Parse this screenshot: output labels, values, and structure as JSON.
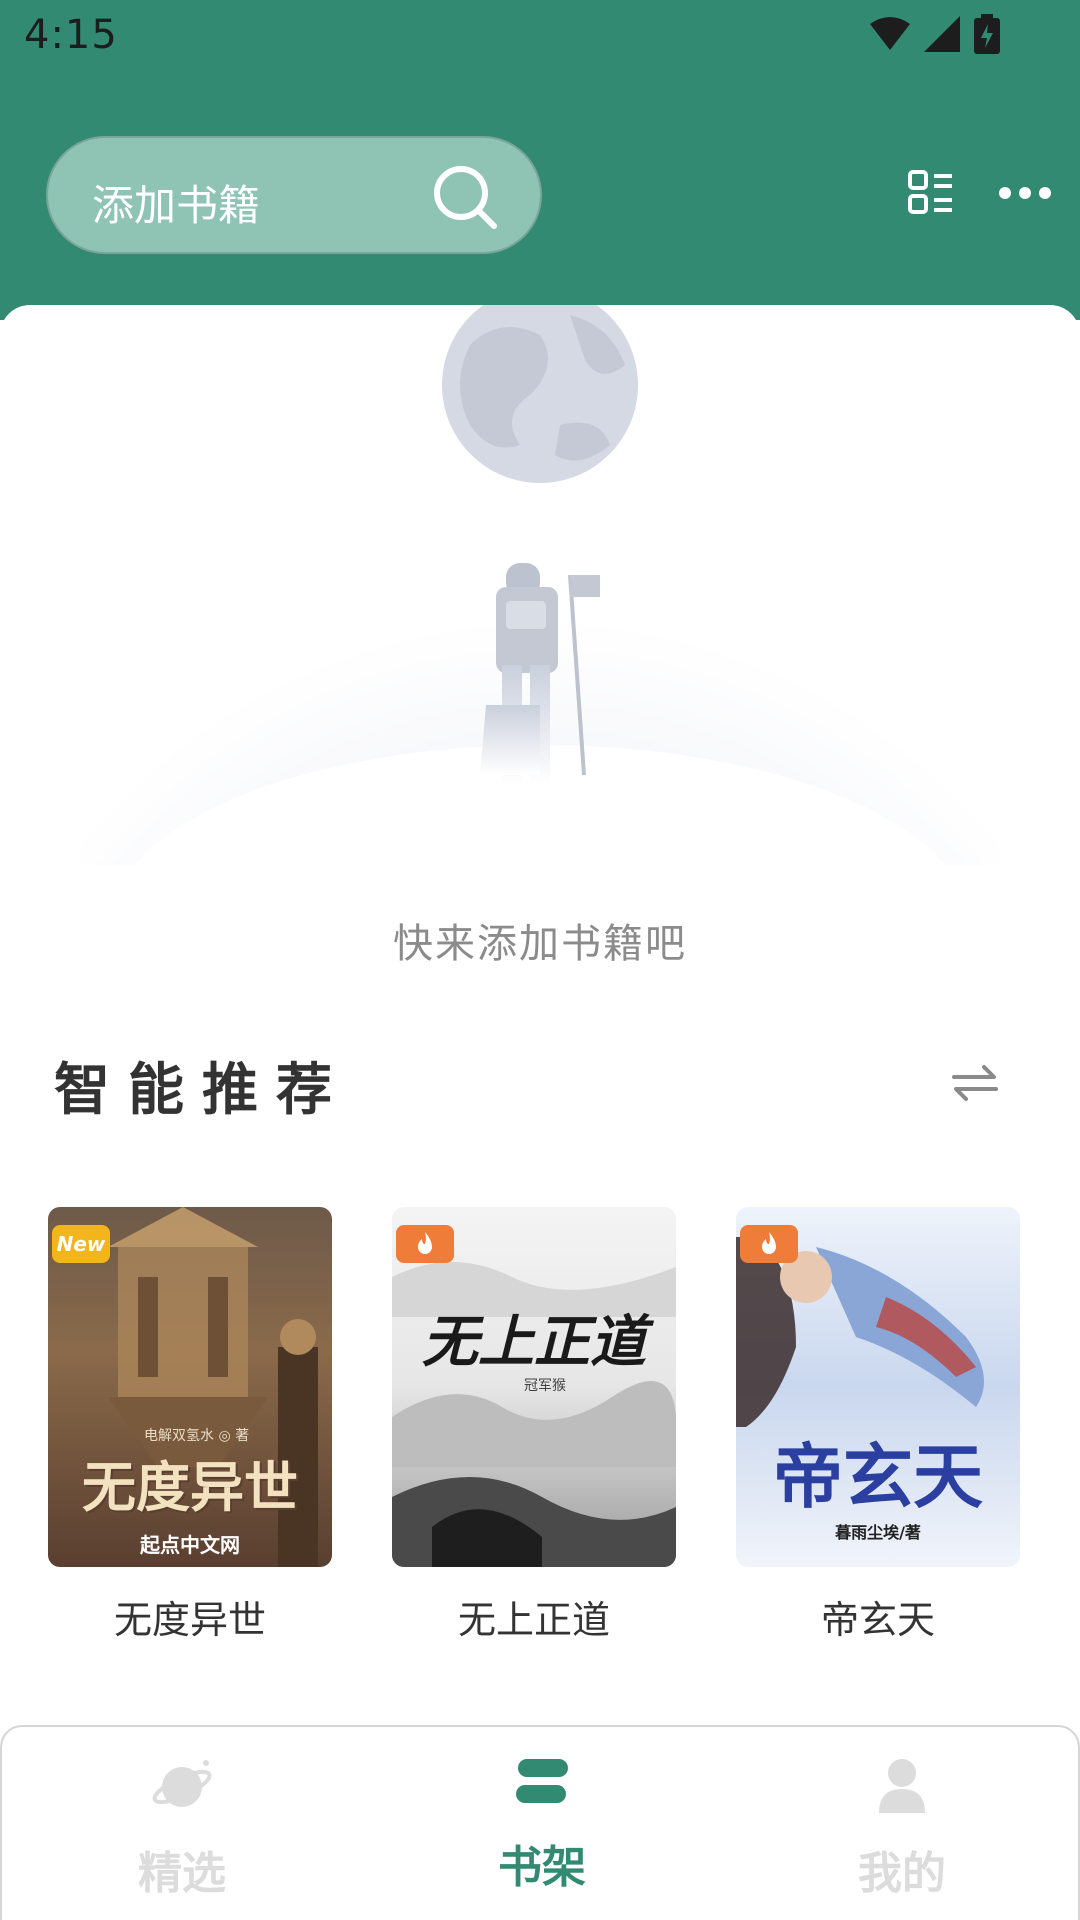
{
  "status_bar": {
    "time": "4:15"
  },
  "header": {
    "search_placeholder": "添加书籍",
    "colors": {
      "primary": "#338a73",
      "search_bg": "#8fc3b3"
    }
  },
  "empty_state": {
    "text": "快来添加书籍吧"
  },
  "recommend": {
    "title": "智能推荐",
    "books": [
      {
        "title": "无度异世",
        "badge": "New",
        "cover_title": "无度异世",
        "cover_sub": "起点中文网",
        "cover_author": "电解双氢水 ◎ 著"
      },
      {
        "title": "无上正道",
        "badge": "hot",
        "cover_title": "无上正道",
        "cover_author": "冠军猴"
      },
      {
        "title": "帝玄天",
        "badge": "hot",
        "cover_title": "帝玄天",
        "cover_author": "暮雨尘埃/著"
      }
    ]
  },
  "bottom_nav": {
    "items": [
      {
        "label": "精选",
        "active": false
      },
      {
        "label": "书架",
        "active": true
      },
      {
        "label": "我的",
        "active": false
      }
    ]
  }
}
